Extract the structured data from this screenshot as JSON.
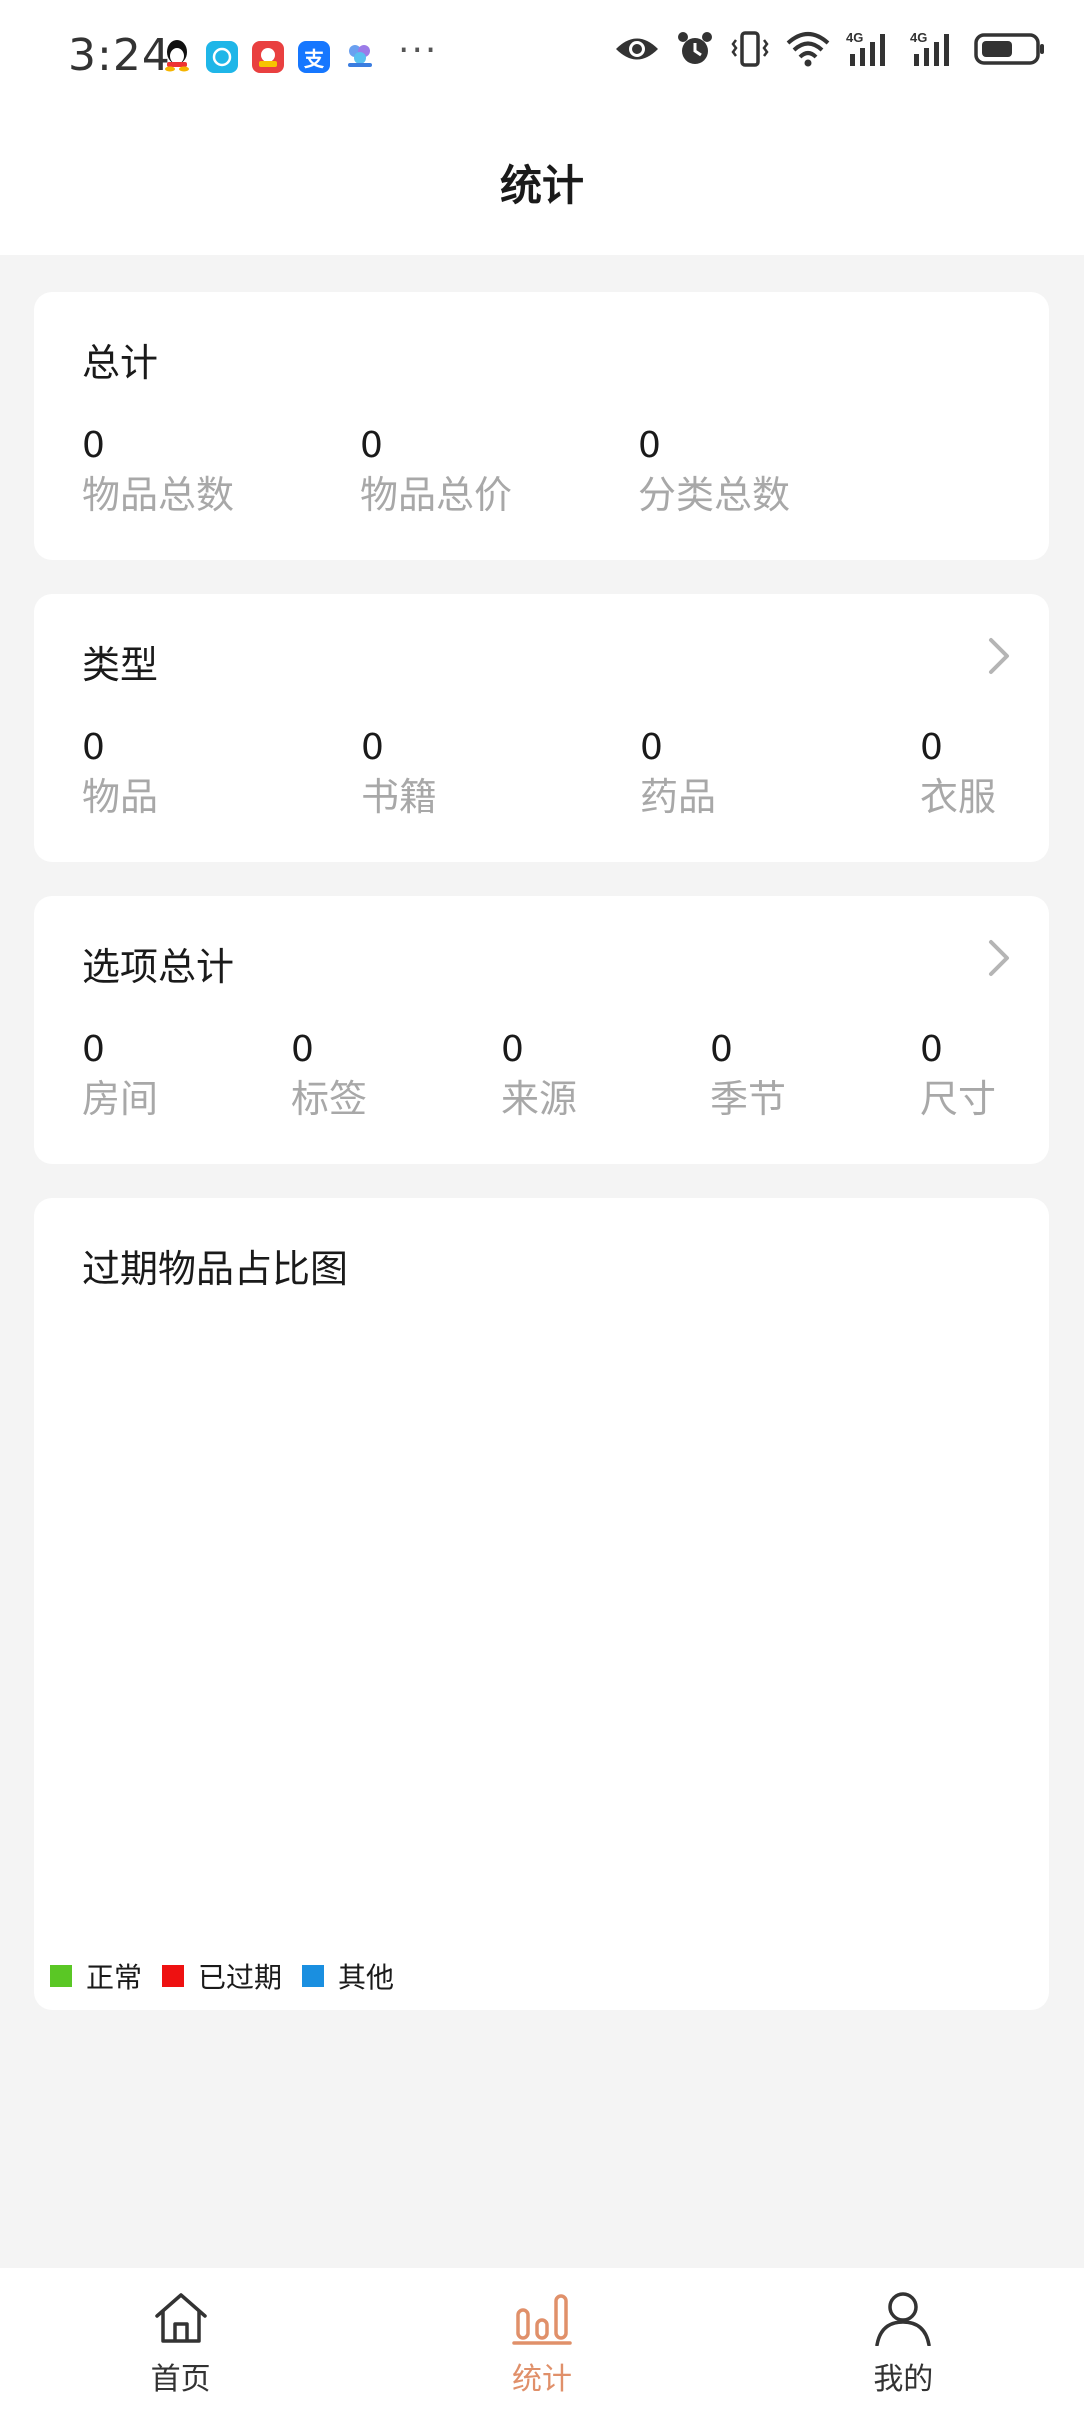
{
  "status_bar": {
    "time": "3:24",
    "more": "···",
    "app_icons": [
      "qq-icon",
      "maps-icon",
      "game-icon",
      "alipay-icon",
      "cloud-app-icon"
    ],
    "alipay_glyph": "支",
    "network_labels": [
      "4G",
      "4G"
    ]
  },
  "header": {
    "title": "统计"
  },
  "totals": {
    "title": "总计",
    "items": [
      {
        "value": "0",
        "label": "物品总数"
      },
      {
        "value": "0",
        "label": "物品总价"
      },
      {
        "value": "0",
        "label": "分类总数"
      }
    ]
  },
  "types": {
    "title": "类型",
    "items": [
      {
        "value": "0",
        "label": "物品"
      },
      {
        "value": "0",
        "label": "书籍"
      },
      {
        "value": "0",
        "label": "药品"
      },
      {
        "value": "0",
        "label": "衣服"
      }
    ]
  },
  "options": {
    "title": "选项总计",
    "items": [
      {
        "value": "0",
        "label": "房间"
      },
      {
        "value": "0",
        "label": "标签"
      },
      {
        "value": "0",
        "label": "来源"
      },
      {
        "value": "0",
        "label": "季节"
      },
      {
        "value": "0",
        "label": "尺寸"
      }
    ]
  },
  "expired_chart": {
    "title": "过期物品占比图",
    "legend": [
      {
        "label": "正常",
        "color": "#5ac725"
      },
      {
        "label": "已过期",
        "color": "#ee1111"
      },
      {
        "label": "其他",
        "color": "#1a8fe0"
      }
    ]
  },
  "chart_data": {
    "type": "pie",
    "title": "过期物品占比图",
    "categories": [
      "正常",
      "已过期",
      "其他"
    ],
    "values": [],
    "colors": [
      "#5ac725",
      "#ee1111",
      "#1a8fe0"
    ],
    "legend": "bottom-left"
  },
  "tabbar": {
    "active_color": "#e0906a",
    "inactive_color": "#333333",
    "tabs": [
      {
        "label": "首页",
        "icon": "home-icon",
        "active": false
      },
      {
        "label": "统计",
        "icon": "bar-chart-icon",
        "active": true
      },
      {
        "label": "我的",
        "icon": "person-icon",
        "active": false
      }
    ]
  }
}
